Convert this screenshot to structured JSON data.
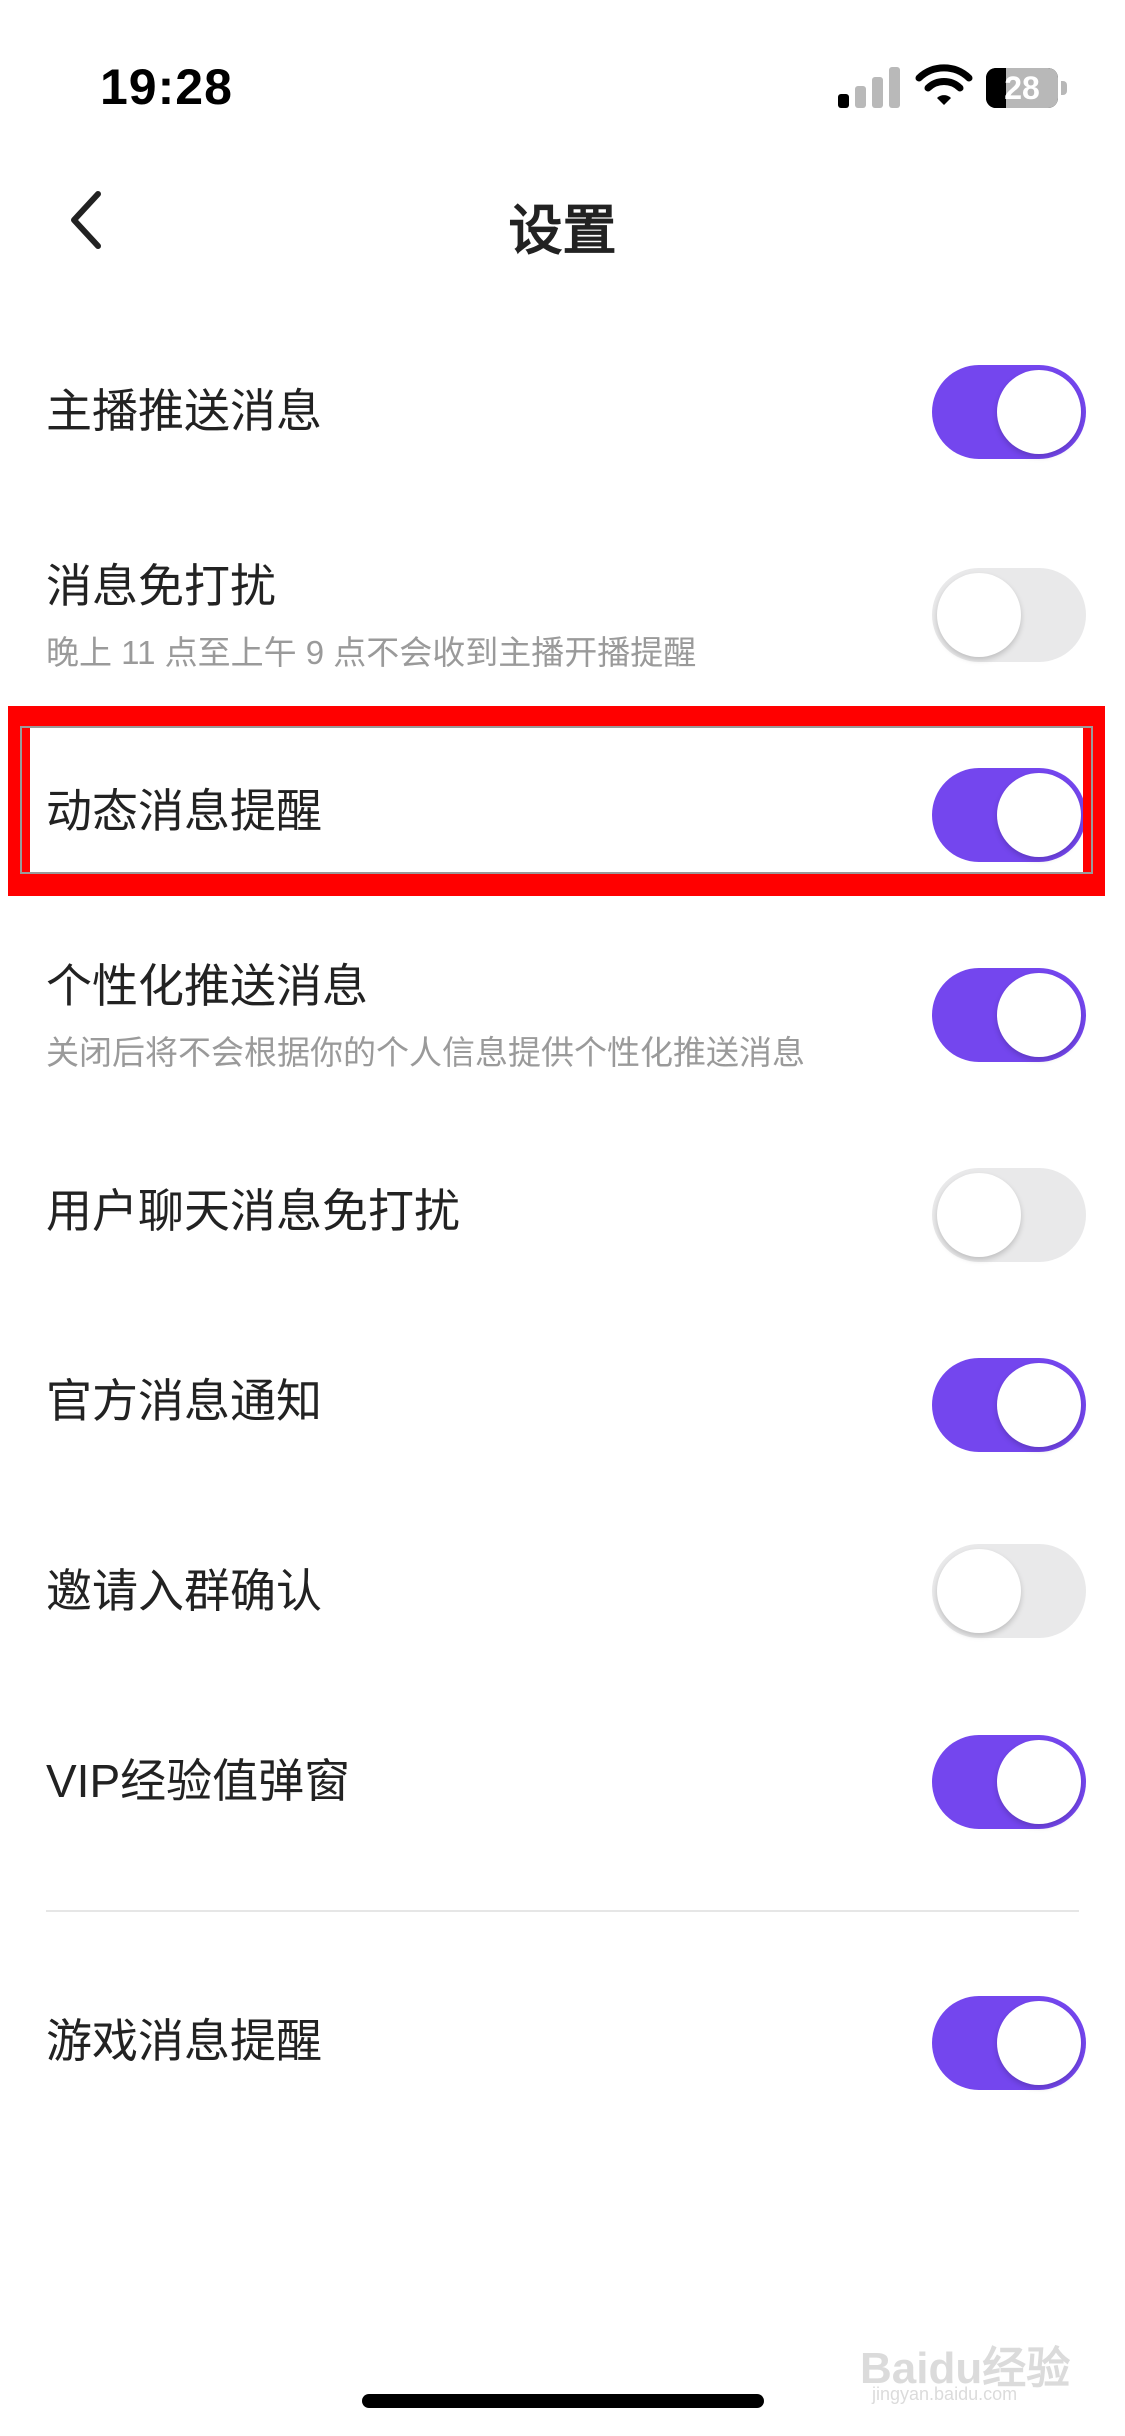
{
  "status_bar": {
    "time": "19:28",
    "battery_level": "28",
    "battery_fraction": 0.28,
    "signal_icon": "cellular-signal-icon",
    "wifi_icon": "wifi-icon"
  },
  "nav": {
    "title": "设置",
    "back_icon": "chevron-left-icon"
  },
  "colors": {
    "toggle_on": "#7446ee",
    "toggle_off": "#e9e9ea",
    "highlight": "#ff0000"
  },
  "settings": [
    {
      "label": "主播推送消息",
      "subtitle": "",
      "enabled": true
    },
    {
      "label": "消息免打扰",
      "subtitle": "晚上 11 点至上午 9 点不会收到主播开播提醒",
      "enabled": false
    },
    {
      "label": "动态消息提醒",
      "subtitle": "",
      "enabled": true,
      "highlighted": true
    },
    {
      "label": "个性化推送消息",
      "subtitle": "关闭后将不会根据你的个人信息提供个性化推送消息",
      "enabled": true
    },
    {
      "label": "用户聊天消息免打扰",
      "subtitle": "",
      "enabled": false
    },
    {
      "label": "官方消息通知",
      "subtitle": "",
      "enabled": true
    },
    {
      "label": "邀请入群确认",
      "subtitle": "",
      "enabled": false
    },
    {
      "label": "VIP经验值弹窗",
      "subtitle": "",
      "enabled": true
    },
    {
      "label": "游戏消息提醒",
      "subtitle": "",
      "enabled": true
    }
  ],
  "watermark": {
    "brand": "Baidu经验",
    "site": "jingyan.baidu.com"
  }
}
